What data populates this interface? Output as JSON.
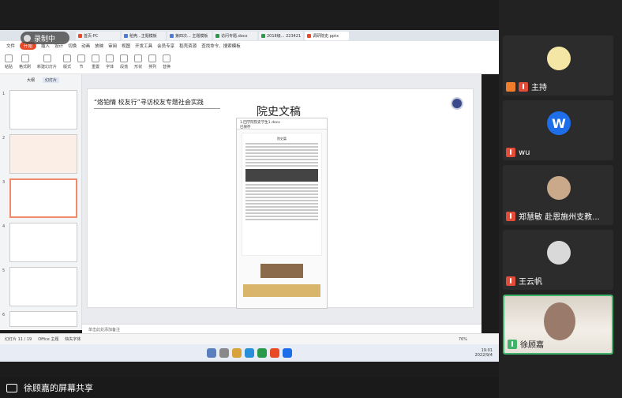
{
  "recording": {
    "label": "录制中"
  },
  "browser": {
    "tabs": [
      {
        "label": "首页-PC",
        "color": "#e84a27",
        "active": false
      },
      {
        "label": "稻壳...主题模板",
        "color": "#4a7bd6",
        "active": false
      },
      {
        "label": "第四次... 主题模板",
        "color": "#4a7bd6",
        "active": false
      },
      {
        "label": "访问专题.docx",
        "color": "#2a9a4a",
        "active": false
      },
      {
        "label": "2018级... 223421",
        "color": "#2a9a4a",
        "active": false
      },
      {
        "label": "调研院史.pptx",
        "color": "#e84a27",
        "active": true
      }
    ]
  },
  "menu": [
    "文件",
    "开始",
    "插入",
    "设计",
    "切换",
    "动画",
    "放映",
    "审阅",
    "视图",
    "开发工具",
    "会员专享",
    "稻壳资源",
    "查找命令、搜索模板"
  ],
  "ribbon": [
    "粘贴",
    "格式刷",
    "新建幻灯片",
    "版式",
    "节",
    "重置",
    "字体",
    "段落",
    "形状",
    "排列",
    "替换"
  ],
  "sidebar": {
    "tabs": [
      "大纲",
      "幻灯片"
    ],
    "slide_numbers": [
      "1",
      "2",
      "3",
      "4",
      "5",
      "6"
    ]
  },
  "slide": {
    "title": "“烙铂情 校友行”寻访校友专题社会实践",
    "section_title": "院史文稿",
    "doc": {
      "filename": "1.回学院院史学生1.docx",
      "subtitle": "已保存",
      "heading": "院史篇"
    }
  },
  "notes": {
    "placeholder": "单击此处添加备注"
  },
  "status": {
    "slide_counter": "幻灯片 11 / 19",
    "theme": "Office 主题",
    "font_missing": "缺失字体",
    "zoom": "76%"
  },
  "tray": {
    "time": "19:01",
    "date": "2022/9/4"
  },
  "share_bar": {
    "label": "徐顾嘉的屏幕共享"
  },
  "participants": [
    {
      "name": "主持",
      "role": "host"
    },
    {
      "name": "wu",
      "initial": "W"
    },
    {
      "name": "郑慧敏 赴恩施州支教..."
    },
    {
      "name": "王云帆"
    },
    {
      "name": "徐顾嘉",
      "active": true
    }
  ]
}
